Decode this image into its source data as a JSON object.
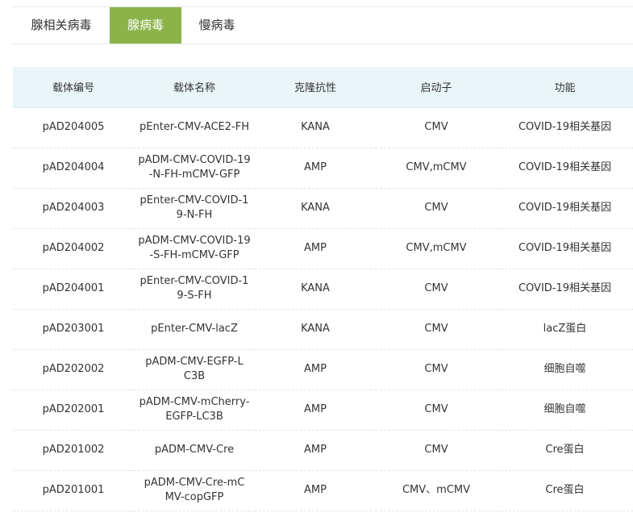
{
  "tabs": [
    {
      "label": "腺相关病毒"
    },
    {
      "label": "腺病毒"
    },
    {
      "label": "慢病毒"
    }
  ],
  "accent_color": "#8bb34a",
  "table": {
    "headers": [
      "载体编号",
      "载体名称",
      "克隆抗性",
      "启动子",
      "功能"
    ],
    "rows": [
      [
        "pAD204005",
        "pEnter-CMV-ACE2-FH",
        "KANA",
        "CMV",
        "COVID-19相关基因"
      ],
      [
        "pAD204004",
        "pADM-CMV-COVID-19-N-FH-mCMV-GFP",
        "AMP",
        "CMV,mCMV",
        "COVID-19相关基因"
      ],
      [
        "pAD204003",
        "pEnter-CMV-COVID-19-N-FH",
        "KANA",
        "CMV",
        "COVID-19相关基因"
      ],
      [
        "pAD204002",
        "pADM-CMV-COVID-19-S-FH-mCMV-GFP",
        "AMP",
        "CMV,mCMV",
        "COVID-19相关基因"
      ],
      [
        "pAD204001",
        "pEnter-CMV-COVID-19-S-FH",
        "KANA",
        "CMV",
        "COVID-19相关基因"
      ],
      [
        "pAD203001",
        "pEnter-CMV-lacZ",
        "KANA",
        "CMV",
        "lacZ蛋白"
      ],
      [
        "pAD202002",
        "pADM-CMV-EGFP-LC3B",
        "AMP",
        "CMV",
        "细胞自噬"
      ],
      [
        "pAD202001",
        "pADM-CMV-mCherry-EGFP-LC3B",
        "AMP",
        "CMV",
        "细胞自噬"
      ],
      [
        "pAD201002",
        "pADM-CMV-Cre",
        "AMP",
        "CMV",
        "Cre蛋白"
      ],
      [
        "pAD201001",
        "pADM-CMV-Cre-mCMV-copGFP",
        "AMP",
        "CMV、mCMV",
        "Cre蛋白"
      ]
    ]
  }
}
